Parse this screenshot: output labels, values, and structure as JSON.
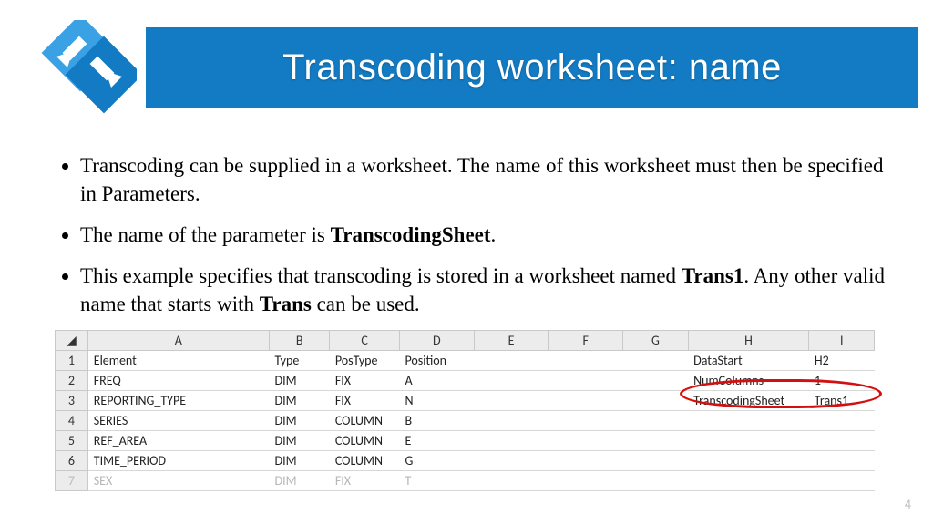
{
  "title": "Transcoding worksheet: name",
  "bullets": {
    "b1a": "Transcoding can be supplied in a worksheet. The name of this worksheet must then be specified in Parameters.",
    "b2a": "The name of the parameter is ",
    "b2b": "TranscodingSheet",
    "b2c": ".",
    "b3a": "This example specifies that transcoding is stored in a worksheet named ",
    "b3b": "Trans1",
    "b3c": ". Any other valid name that starts with ",
    "b3d": "Trans",
    "b3e": " can be used."
  },
  "sheet": {
    "columns": [
      "A",
      "B",
      "C",
      "D",
      "E",
      "F",
      "G",
      "H",
      "I"
    ],
    "header_row": {
      "A": "Element",
      "B": "Type",
      "C": "PosType",
      "D": "Position",
      "H": "DataStart",
      "I": "H2"
    },
    "rows": [
      {
        "n": "2",
        "A": "FREQ",
        "B": "DIM",
        "C": "FIX",
        "D": "A",
        "H": "NumColumns",
        "I": "1"
      },
      {
        "n": "3",
        "A": "REPORTING_TYPE",
        "B": "DIM",
        "C": "FIX",
        "D": "N",
        "H": "TranscodingSheet",
        "I": "Trans1",
        "highlight": true
      },
      {
        "n": "4",
        "A": "SERIES",
        "B": "DIM",
        "C": "COLUMN",
        "D": "B"
      },
      {
        "n": "5",
        "A": "REF_AREA",
        "B": "DIM",
        "C": "COLUMN",
        "D": "E"
      },
      {
        "n": "6",
        "A": "TIME_PERIOD",
        "B": "DIM",
        "C": "COLUMN",
        "D": "G"
      }
    ],
    "faded_row": {
      "n": "7",
      "A": "SEX",
      "B": "DIM",
      "C": "FIX",
      "D": "T"
    }
  },
  "page_number": "4"
}
